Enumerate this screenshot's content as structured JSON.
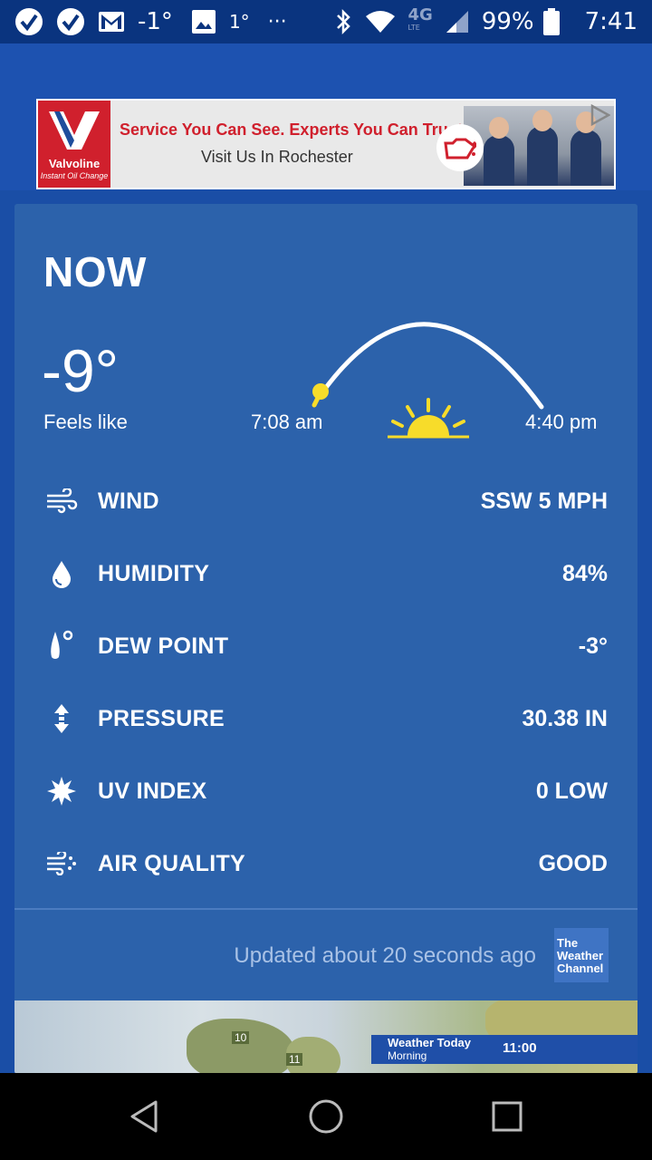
{
  "status_bar": {
    "temp_1": "-1°",
    "temp_2": "1°",
    "more": "···",
    "network": "4G",
    "network_sub": "LTE",
    "battery": "99%",
    "time": "7:41"
  },
  "ad": {
    "brand": "Valvoline",
    "brand_sub": "Instant Oil Change",
    "headline": "Service You Can See. Experts You Can Trust.",
    "subline": "Visit Us In Rochester"
  },
  "current": {
    "title": "NOW",
    "temperature": "-9°",
    "feels_like_label": "Feels like",
    "sunrise": "7:08 am",
    "sunset": "4:40 pm"
  },
  "details": [
    {
      "label": "WIND",
      "value": "SSW 5 MPH",
      "icon": "wind-icon"
    },
    {
      "label": "HUMIDITY",
      "value": "84%",
      "icon": "humidity-drop-icon"
    },
    {
      "label": "DEW POINT",
      "value": "-3°",
      "icon": "dew-point-icon"
    },
    {
      "label": "PRESSURE",
      "value": "30.38 IN",
      "icon": "pressure-icon"
    },
    {
      "label": "UV INDEX",
      "value": "0 LOW",
      "icon": "uv-sun-icon"
    },
    {
      "label": "AIR QUALITY",
      "value": "GOOD",
      "icon": "air-quality-icon"
    }
  ],
  "footer": {
    "updated": "Updated about 20 seconds ago",
    "logo_line1": "The",
    "logo_line2": "Weather",
    "logo_line3": "Channel"
  },
  "video": {
    "caption_title": "Weather Today",
    "caption_sub": "Morning",
    "caption_time": "11:00",
    "badge_1": "10",
    "badge_2": "11"
  },
  "colors": {
    "background": "#1a4ea6",
    "card": "#2c62ab",
    "status_bar": "#0a347f",
    "sun_yellow": "#f7dc2a",
    "updated_text": "#a9c2e6"
  }
}
